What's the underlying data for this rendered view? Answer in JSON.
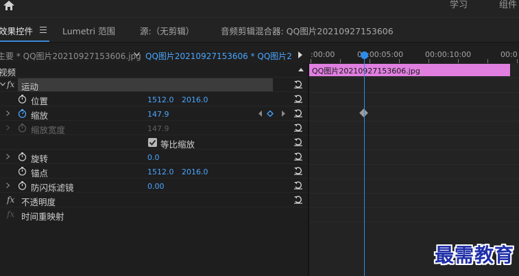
{
  "workspace": {
    "items": [
      "学习",
      "组件"
    ]
  },
  "tabs": {
    "effect_controls": "效果控件",
    "lumetri": "Lumetri 范围",
    "source": "源:（无剪辑）",
    "audio_mixer": "音频剪辑混合器: QQ图片20210927153606"
  },
  "clip_header": {
    "master": "主要 * QQ图片20210927153606.jpg",
    "sequence": "QQ图片20210927153606 * QQ图片2..."
  },
  "ruler": {
    "labels": [
      ":00:00",
      "00:00:05:00",
      "00:00:10:00",
      "00:0"
    ]
  },
  "timeline": {
    "clip_name": "QQ图片20210927153606.jpg",
    "clip_color": "#e07fe0",
    "playhead_color": "#2d8ceb"
  },
  "effects": {
    "video_section": "视频",
    "motion": "运动",
    "position": {
      "label": "位置",
      "x": "1512.0",
      "y": "2016.0"
    },
    "scale": {
      "label": "缩放",
      "value": "147.9"
    },
    "scale_width": {
      "label": "缩放宽度",
      "value": "147.9"
    },
    "uniform_scale": {
      "label": "等比缩放"
    },
    "rotation": {
      "label": "旋转",
      "value": "0.0"
    },
    "anchor": {
      "label": "锚点",
      "x": "1512.0",
      "y": "2016.0"
    },
    "antiflicker": {
      "label": "防闪烁滤镜",
      "value": "0.00"
    },
    "opacity": "不透明度",
    "time_remap": "时间重映射",
    "value_color": "#4aa6ff"
  },
  "watermark": "最需教育"
}
